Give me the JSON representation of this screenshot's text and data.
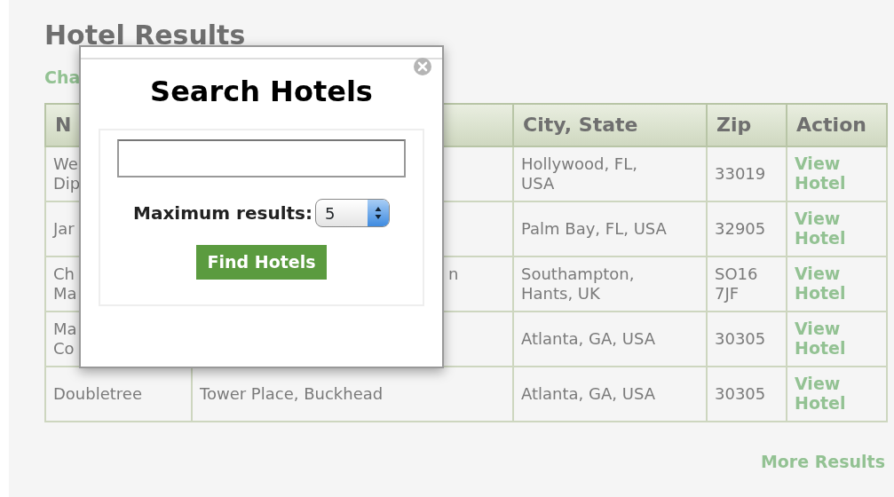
{
  "page": {
    "title": "Hotel Results",
    "change_link": "Cha"
  },
  "table": {
    "columns": [
      {
        "kind": "name",
        "label": "N"
      },
      {
        "kind": "address"
      },
      {
        "kind": "city",
        "label": "City, State"
      },
      {
        "kind": "zip",
        "label": "Zip"
      },
      {
        "kind": "action",
        "label": "Action"
      }
    ],
    "rows": [
      {
        "name": "We\nDip",
        "city": "Hollywood, FL,\nUSA",
        "zip": "33019",
        "action": "View\nHotel"
      },
      {
        "name": "Jar",
        "city": "Palm Bay, FL, USA",
        "zip": "32905",
        "action": "View\nHotel"
      },
      {
        "name": "Ch\nMa",
        "address": "n\n ",
        "city": "Southampton,\nHants, UK",
        "zip": "SO16\n7JF",
        "action": "View\nHotel"
      },
      {
        "name": "Ma\nCo",
        "city": "Atlanta, GA, USA",
        "zip": "30305",
        "action": "View\nHotel"
      },
      {
        "name": "Doubletree",
        "address": "Tower Place, Buckhead",
        "city": "Atlanta, GA, USA",
        "zip": "30305",
        "action": "View\nHotel"
      }
    ]
  },
  "more_link": "More Results",
  "dialog": {
    "title": "Search Hotels",
    "max_label": "Maximum results:",
    "max_value": "5",
    "button": "Find Hotels"
  }
}
